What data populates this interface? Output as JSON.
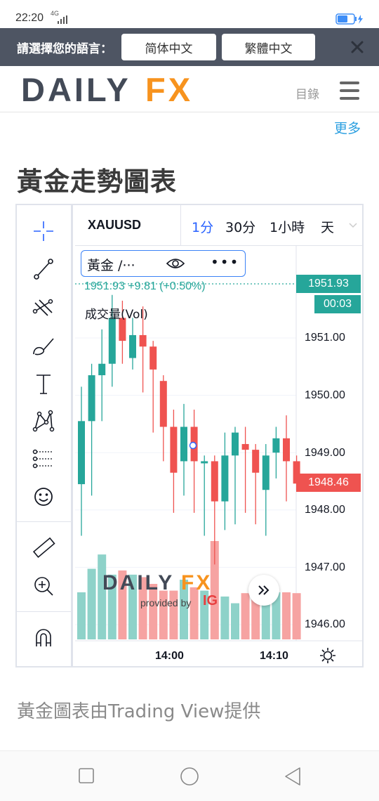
{
  "status_bar": {
    "time": "22:20",
    "network": "4G"
  },
  "language_bar": {
    "prompt": "請選擇您的語言：",
    "options": [
      "简体中文",
      "繁體中文"
    ]
  },
  "header": {
    "logo_left": "DAILY",
    "logo_right": "FX",
    "menu_label": "目錄"
  },
  "more_link": "更多",
  "page_title": "黃金走勢圖表",
  "chart": {
    "symbol": "XAUUSD",
    "timeframes": [
      "1分",
      "30分",
      "1小時",
      "天"
    ],
    "active_timeframe": "1分",
    "legend_name": "黃金 /···",
    "legend_more": "•••",
    "quote": "1951.93  +9.81 (+0.50%)",
    "volume_label": "成交量(Vol)",
    "last_price_tag": "1951.93",
    "countdown_tag": "00:03",
    "current_price_tag": "1948.46",
    "price_axis": [
      "1951.00",
      "1950.00",
      "1949.00",
      "1948.00",
      "1947.00",
      "1946.00"
    ],
    "time_axis": [
      "14:00",
      "14:10"
    ],
    "watermark_logo_left": "DAILY",
    "watermark_logo_right": "FX",
    "watermark_provided": "provided by",
    "watermark_brand": "IG",
    "colors": {
      "up": "#26a69a",
      "down": "#ef5350",
      "accent": "#2962ff",
      "brand_orange": "#f7931e"
    }
  },
  "chart_data": {
    "type": "candlestick",
    "title": "XAUUSD",
    "x_ticks": [
      "14:00",
      "14:10"
    ],
    "y_ticks": [
      1951.0,
      1950.0,
      1949.0,
      1948.0,
      1947.0,
      1946.0
    ],
    "ylim": [
      1945.8,
      1952.4
    ],
    "candles": [
      {
        "open": 1948.45,
        "close": 1949.55,
        "high": 1950.15,
        "low": 1947.55,
        "up": true
      },
      {
        "open": 1949.55,
        "close": 1950.35,
        "high": 1950.55,
        "low": 1948.25,
        "up": true
      },
      {
        "open": 1950.35,
        "close": 1950.55,
        "high": 1951.15,
        "low": 1949.55,
        "up": true
      },
      {
        "open": 1950.55,
        "close": 1951.35,
        "high": 1951.75,
        "low": 1950.15,
        "up": true
      },
      {
        "open": 1951.35,
        "close": 1950.95,
        "high": 1951.65,
        "low": 1950.55,
        "up": false
      },
      {
        "open": 1950.65,
        "close": 1951.05,
        "high": 1951.35,
        "low": 1950.45,
        "up": true
      },
      {
        "open": 1951.05,
        "close": 1950.85,
        "high": 1951.55,
        "low": 1950.05,
        "up": false
      },
      {
        "open": 1950.85,
        "close": 1950.45,
        "high": 1950.95,
        "low": 1949.35,
        "up": false
      },
      {
        "open": 1950.25,
        "close": 1949.45,
        "high": 1950.35,
        "low": 1948.85,
        "up": false
      },
      {
        "open": 1949.45,
        "close": 1948.65,
        "high": 1949.75,
        "low": 1947.95,
        "up": false
      },
      {
        "open": 1948.85,
        "close": 1949.45,
        "high": 1949.85,
        "low": 1948.25,
        "up": true
      },
      {
        "open": 1949.45,
        "close": 1948.85,
        "high": 1949.75,
        "low": 1947.95,
        "up": false
      },
      {
        "open": 1948.85,
        "close": 1948.85,
        "high": 1948.95,
        "low": 1947.55,
        "up": true
      },
      {
        "open": 1948.85,
        "close": 1948.15,
        "high": 1948.95,
        "low": 1947.05,
        "up": false
      },
      {
        "open": 1948.15,
        "close": 1948.95,
        "high": 1949.35,
        "low": 1947.65,
        "up": true
      },
      {
        "open": 1948.95,
        "close": 1949.35,
        "high": 1949.45,
        "low": 1947.75,
        "up": true
      },
      {
        "open": 1949.15,
        "close": 1949.05,
        "high": 1949.45,
        "low": 1947.95,
        "up": false
      },
      {
        "open": 1949.05,
        "close": 1948.65,
        "high": 1949.15,
        "low": 1947.75,
        "up": false
      },
      {
        "open": 1948.35,
        "close": 1948.95,
        "high": 1949.15,
        "low": 1947.55,
        "up": true
      },
      {
        "open": 1949.0,
        "close": 1949.25,
        "high": 1949.45,
        "low": 1948.55,
        "up": true
      },
      {
        "open": 1949.25,
        "close": 1948.85,
        "high": 1949.65,
        "low": 1948.15,
        "up": false
      },
      {
        "open": 1948.85,
        "close": 1948.46,
        "high": 1948.95,
        "low": 1948.35,
        "up": false
      }
    ],
    "volumes": [
      5.6,
      8.4,
      10.1,
      7.7,
      8.2,
      7.7,
      7.4,
      6.6,
      5.8,
      5.8,
      7.1,
      6.2,
      5.8,
      11.7,
      5.1,
      4.3,
      5.5,
      5.5,
      5.6,
      5.6,
      5.6,
      5.5
    ]
  }
}
